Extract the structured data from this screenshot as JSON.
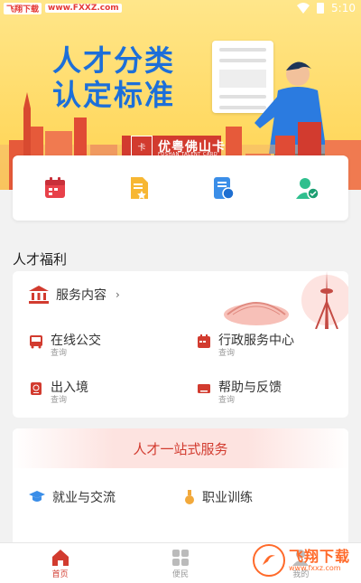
{
  "status_bar": {
    "watermark": "飞翔下载",
    "watermark_url": "www.FXXZ.com",
    "time": "5:10"
  },
  "banner": {
    "title_line1": "人才分类",
    "title_line2": "认定标准",
    "brand_name": "优粤佛山卡",
    "brand_sub": "FOSHAN TALENT CARD"
  },
  "quick_icons": [
    "calendar-icon",
    "document-star-icon",
    "id-card-icon",
    "user-badge-icon"
  ],
  "welfare": {
    "heading": "人才福利",
    "service_content": "服务内容",
    "items": [
      {
        "label": "在线公交",
        "sub": "查询"
      },
      {
        "label": "行政服务中心",
        "sub": "查询"
      },
      {
        "label": "出入境",
        "sub": "查询"
      },
      {
        "label": "帮助与反馈",
        "sub": "查询"
      }
    ]
  },
  "one_stop": {
    "title": "人才一站式服务",
    "items": [
      "就业与交流",
      "职业训练"
    ]
  },
  "tabs": [
    {
      "label": "首页",
      "active": true
    },
    {
      "label": "便民",
      "active": false
    },
    {
      "label": "我的",
      "active": false
    }
  ],
  "watermark_badge": {
    "text": "飞翔下载",
    "url": "www.fxxz.com"
  },
  "colors": {
    "accent_red": "#d23b2f",
    "banner_yellow": "#ffd34f",
    "title_blue": "#1c6fd9"
  }
}
